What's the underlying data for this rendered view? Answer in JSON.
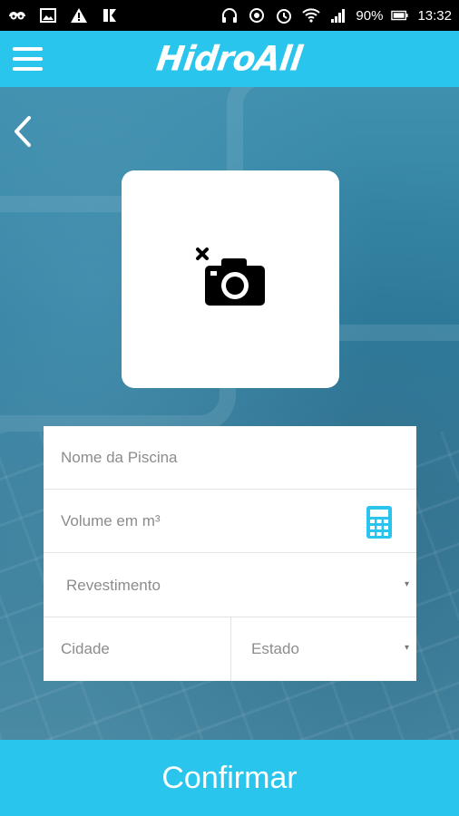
{
  "status_bar": {
    "battery_percent": "90%",
    "time": "13:32",
    "left_icons": [
      "drive-icon",
      "image-icon",
      "warning-icon",
      "app-notification-icon"
    ],
    "right_icons": [
      "headphones-icon",
      "sync-icon",
      "alarm-icon",
      "wifi-icon",
      "signal-icon",
      "battery-icon"
    ]
  },
  "app_bar": {
    "title": "HidroAll",
    "menu_icon": "hamburger-menu-icon"
  },
  "nav": {
    "back_icon": "chevron-left-icon"
  },
  "photo": {
    "icon": "camera-remove-icon"
  },
  "form": {
    "pool_name_placeholder": "Nome da Piscina",
    "volume_placeholder": "Volume em m³",
    "volume_icon": "calculator-icon",
    "coating_label": "Revestimento",
    "city_placeholder": "Cidade",
    "state_label": "Estado",
    "dropdown_arrow": "▾"
  },
  "confirm": {
    "label": "Confirmar"
  },
  "colors": {
    "accent": "#29c5ec",
    "form_background": "#ffffff",
    "placeholder": "#8c8c8c"
  }
}
